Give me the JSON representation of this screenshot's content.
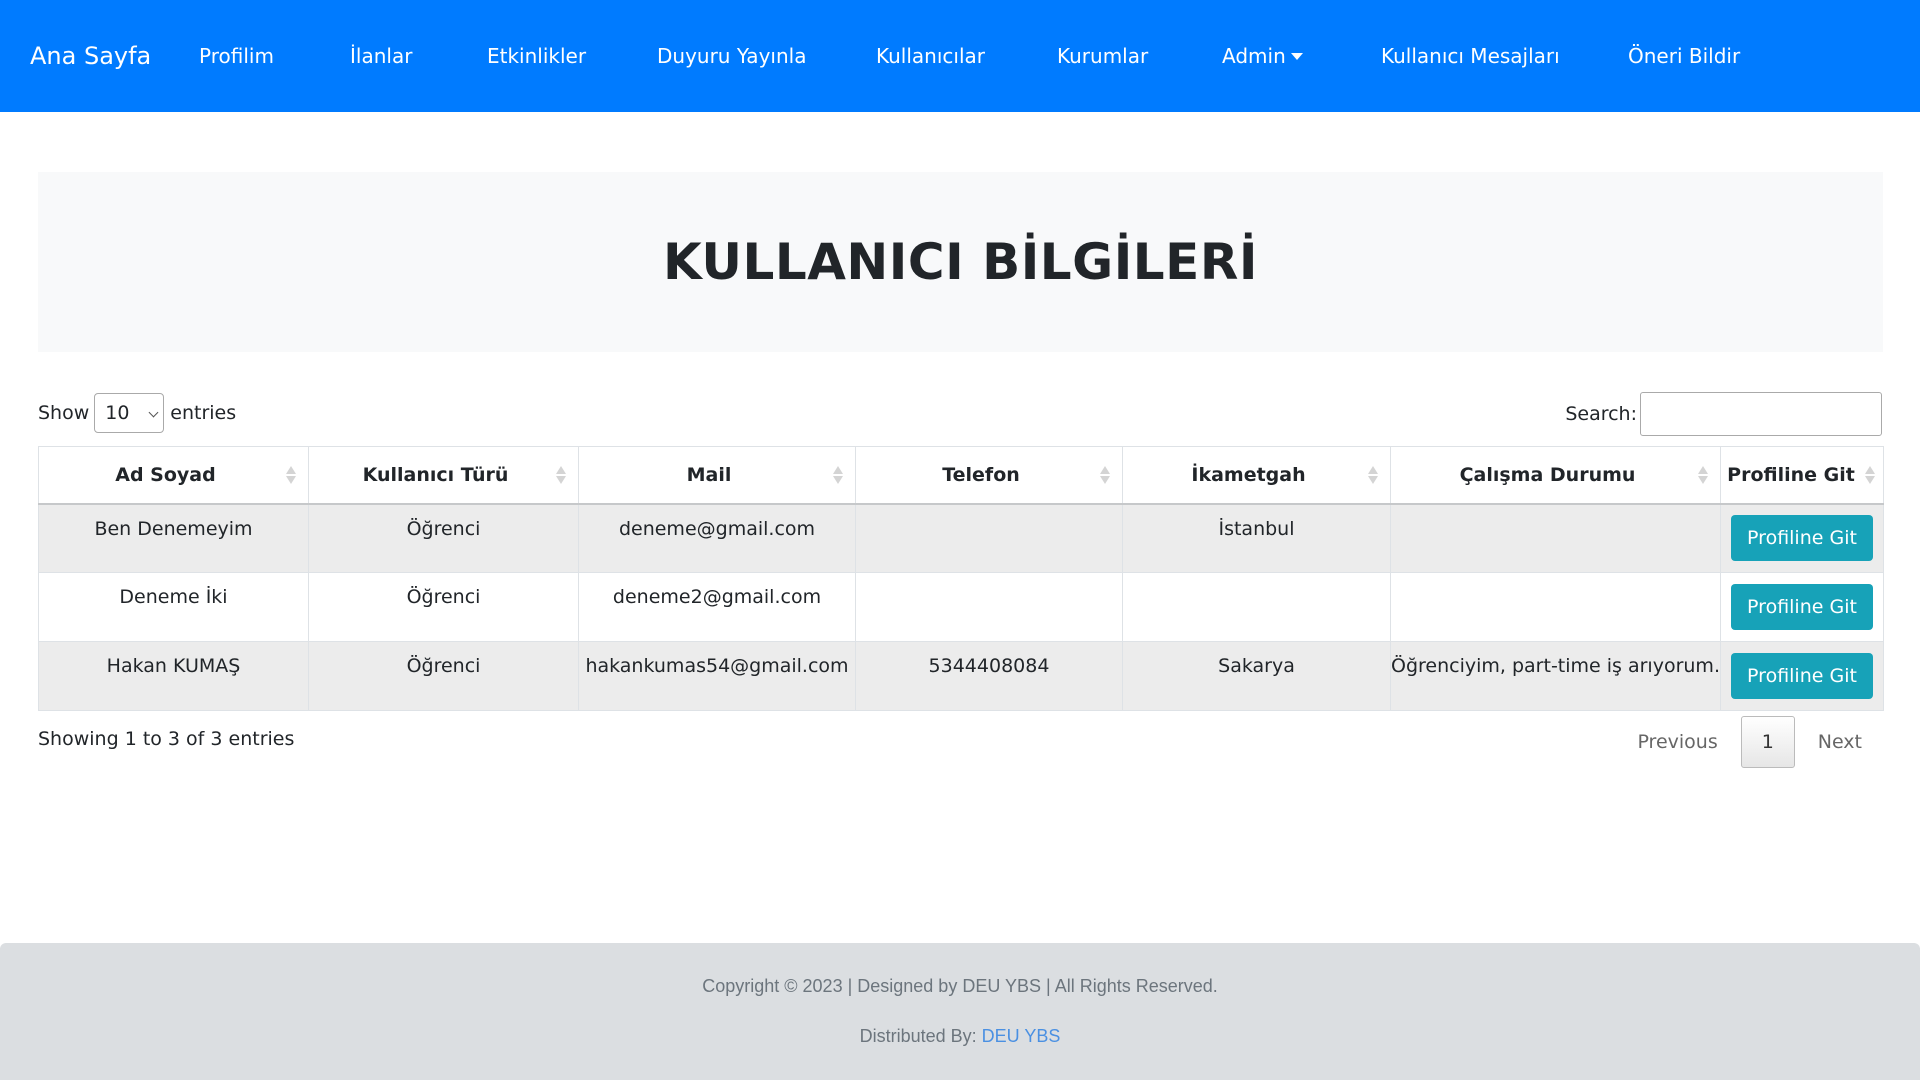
{
  "nav": {
    "brand": "Ana Sayfa",
    "items": [
      "Profilim",
      "İlanlar",
      "Etkinlikler",
      "Duyuru Yayınla",
      "Kullanıcılar",
      "Kurumlar",
      "Admin",
      "Kullanıcı Mesajları",
      "Öneri Bildir"
    ]
  },
  "page": {
    "title": "KULLANICI BİLGİLERİ"
  },
  "datatable": {
    "show_label": "Show",
    "entries_value": "10",
    "entries_label": "entries",
    "search_label": "Search:",
    "search_value": "",
    "columns": [
      "Ad Soyad",
      "Kullanıcı Türü",
      "Mail",
      "Telefon",
      "İkametgah",
      "Çalışma Durumu",
      "Profiline Git"
    ],
    "rows": [
      [
        "Ben Denemeyim",
        "Öğrenci",
        "deneme@gmail.com",
        "",
        "İstanbul",
        "",
        "Profiline Git"
      ],
      [
        "Deneme İki",
        "Öğrenci",
        "deneme2@gmail.com",
        "",
        "",
        "",
        "Profiline Git"
      ],
      [
        "Hakan KUMAŞ",
        "Öğrenci",
        "hakankumas54@gmail.com",
        "5344408084",
        "Sakarya",
        "Öğrenciyim, part-time iş arıyorum.",
        "Profiline Git"
      ]
    ],
    "info": "Showing 1 to 3 of 3 entries",
    "pagination": {
      "previous": "Previous",
      "current": "1",
      "next": "Next"
    }
  },
  "footer": {
    "copyright": "Copyright © 2023 | Designed by DEU YBS | All Rights Reserved.",
    "distributed_label": "Distributed By:",
    "distributed_link": "DEU YBS"
  },
  "colors": {
    "navbar": "#007bff",
    "button": "#17a2b8",
    "jumbotron": "#f8f9fa",
    "footer": "#dbdee1",
    "link": "#4a90e2"
  }
}
